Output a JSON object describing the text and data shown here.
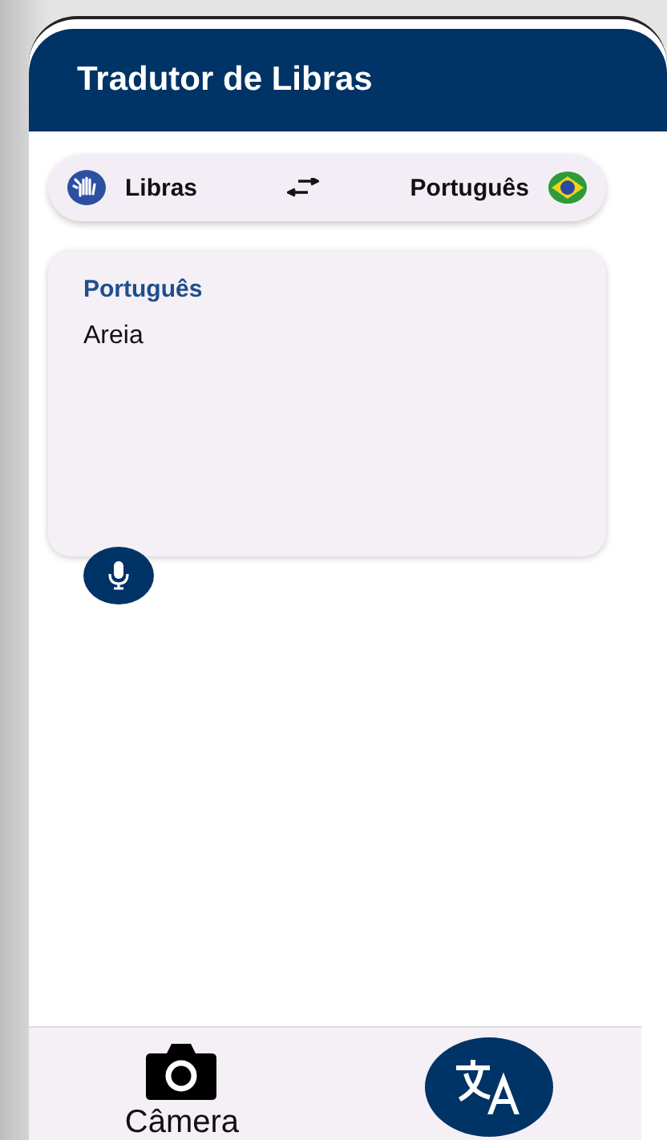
{
  "app_bar": {
    "title": "Tradutor de Libras"
  },
  "language_bar": {
    "source": "Libras",
    "target": "Português"
  },
  "input_card": {
    "label": "Português",
    "text": "Areia"
  },
  "bottom_nav": [
    {
      "kind": "camera",
      "label": "Câmera",
      "selected": false
    },
    {
      "kind": "translate",
      "selected": true
    }
  ]
}
